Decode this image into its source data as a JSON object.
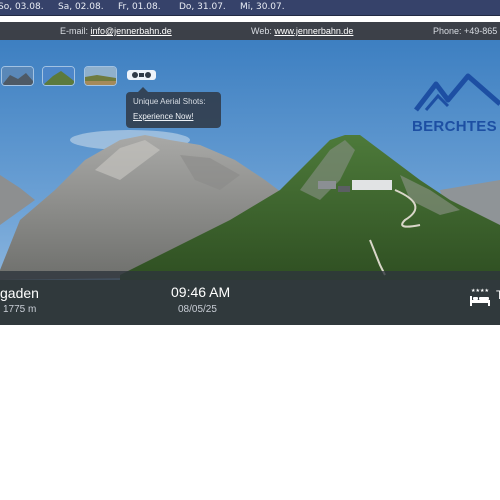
{
  "dates": [
    "So, 03.08.",
    "Sa, 02.08.",
    "Fr, 01.08.",
    "Do, 31.07.",
    "Mi, 30.07."
  ],
  "contact": {
    "email_label": "E-mail:",
    "email": "info@jennerbahn.de",
    "web_label": "Web:",
    "web": "www.jennerbahn.de",
    "phone": "Phone: +49-865"
  },
  "tooltip": {
    "title": "Unique Aerial Shots:",
    "link": "Experience Now!"
  },
  "brand": {
    "name": "BERCHTES",
    "color": "#1d4fa3"
  },
  "info": {
    "location": "gaden",
    "altitude": "1775 m",
    "time": "09:46 AM",
    "date": "08/05/25",
    "hotel_icon": "bed-icon",
    "hotel_text": "T"
  }
}
